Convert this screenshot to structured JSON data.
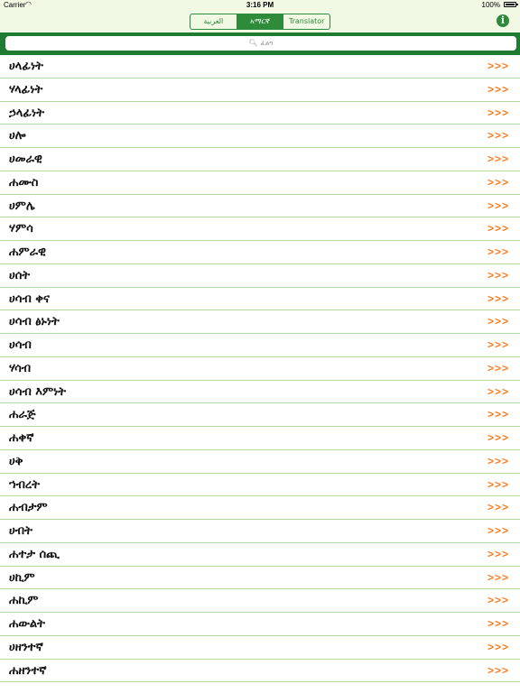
{
  "status_bar": {
    "carrier": "Carrier",
    "time": "3:16 PM",
    "battery": "100%"
  },
  "segments": [
    {
      "label": "العربية",
      "active": false
    },
    {
      "label": "አማርኛ",
      "active": true
    },
    {
      "label": "Translator",
      "active": false
    }
  ],
  "info_button": "i",
  "search": {
    "placeholder": "ፈልግ"
  },
  "colors": {
    "accent_green": "#2e8b3a",
    "search_bar_green": "#1f7a32",
    "arrow_orange": "#f47d1f"
  },
  "row_arrow": ">>>",
  "words": [
    "ሀላፊነት",
    "ሃላፊነት",
    "ኃላፊነት",
    "ሀሎ",
    "ሀመራዊ",
    "ሐሙስ",
    "ሀምሌ",
    "ሃምሳ",
    "ሐምራዊ",
    "ሀሰት",
    "ሀሳብ ቀና",
    "ሀሳብ ፅኑነት",
    "ሀሳብ",
    "ሃሳብ",
    "ሀሳብ እምነት",
    "ሐራጅ",
    "ሐቀኛ",
    "ሀቅ",
    "ኀብረት",
    "ሐብታም",
    "ሀብት",
    "ሐተታ ሰጪ",
    "ሀኪም",
    "ሐኪም",
    "ሐውልት",
    "ሀዘንተኛ",
    "ሐዘንተኛ"
  ]
}
